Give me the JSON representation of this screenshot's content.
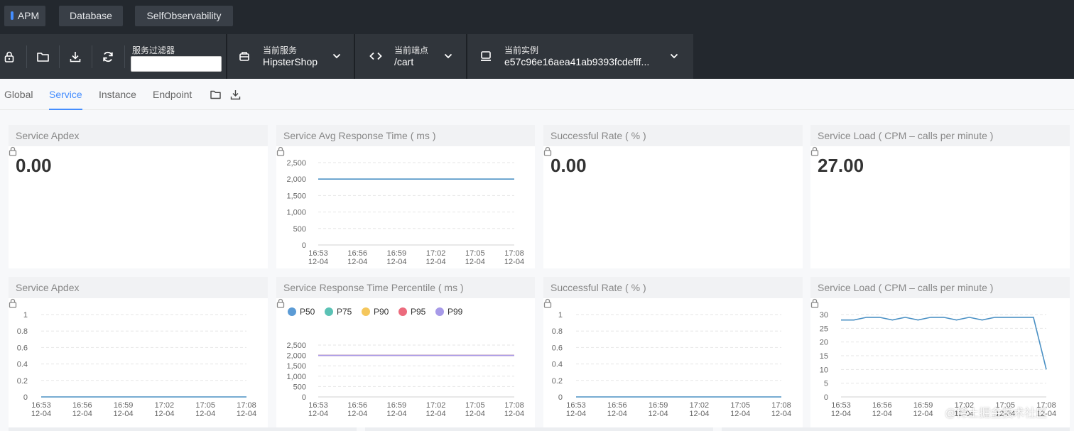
{
  "nav": {
    "tabs": [
      {
        "label": "APM",
        "active": true
      },
      {
        "label": "Database",
        "active": false
      },
      {
        "label": "SelfObservability",
        "active": false
      }
    ]
  },
  "toolbar": {
    "icons": [
      "lock-icon",
      "folder-icon",
      "download-icon",
      "refresh-icon"
    ],
    "filter": {
      "label": "服务过滤器",
      "value": ""
    },
    "service": {
      "label": "当前服务",
      "value": "HipsterShop"
    },
    "endpoint": {
      "label": "当前端点",
      "value": "/cart"
    },
    "instance": {
      "label": "当前实例",
      "value": "e57c96e16aea41ab9393fcdefff..."
    }
  },
  "tabs": [
    {
      "label": "Global",
      "active": false
    },
    {
      "label": "Service",
      "active": true
    },
    {
      "label": "Instance",
      "active": false
    },
    {
      "label": "Endpoint",
      "active": false
    }
  ],
  "panels": {
    "apdex": {
      "title": "Service Apdex",
      "value": "0.00"
    },
    "avg_resp": {
      "title": "Service Avg Response Time ( ms )"
    },
    "success_rate": {
      "title": "Successful Rate ( % )",
      "value": "0.00"
    },
    "load": {
      "title": "Service Load ( CPM – calls per minute )",
      "value": "27.00"
    },
    "apdex_chart": {
      "title": "Service Apdex"
    },
    "percentile": {
      "title": "Service Response Time Percentile ( ms )"
    },
    "success_chart": {
      "title": "Successful Rate ( % )"
    },
    "load_chart": {
      "title": "Service Load ( CPM – calls per minute )"
    }
  },
  "watermark": "@稀土掘金技术社区",
  "colors": {
    "accent": "#448dfe",
    "series_p50": "#5b9bd5",
    "series_p75": "#5bc2b5",
    "series_p90": "#f5c75c",
    "series_p95": "#ec6b7d",
    "series_p99": "#a79ae8"
  },
  "chart_data": [
    {
      "id": "avg_resp",
      "type": "line",
      "x_ticks": [
        [
          "16:53",
          "12-04"
        ],
        [
          "16:56",
          "12-04"
        ],
        [
          "16:59",
          "12-04"
        ],
        [
          "17:02",
          "12-04"
        ],
        [
          "17:05",
          "12-04"
        ],
        [
          "17:08",
          "12-04"
        ]
      ],
      "y_ticks": [
        "2,500",
        "2,000",
        "1,500",
        "1,000",
        "500",
        "0"
      ],
      "ylim": [
        0,
        2500
      ],
      "grid": true,
      "series": [
        {
          "values": [
            2000,
            2000,
            2000,
            2000,
            2000,
            2000,
            2000,
            2000,
            2000,
            2000,
            2000,
            2000,
            2000,
            2000,
            2000,
            2000
          ],
          "color": "#4a90c4"
        }
      ]
    },
    {
      "id": "apdex_chart",
      "type": "line",
      "x_ticks": [
        [
          "16:53",
          "12-04"
        ],
        [
          "16:56",
          "12-04"
        ],
        [
          "16:59",
          "12-04"
        ],
        [
          "17:02",
          "12-04"
        ],
        [
          "17:05",
          "12-04"
        ],
        [
          "17:08",
          "12-04"
        ]
      ],
      "y_ticks": [
        "1",
        "0.8",
        "0.6",
        "0.4",
        "0.2",
        "0"
      ],
      "ylim": [
        0,
        1
      ],
      "grid": true,
      "series": [
        {
          "values": [
            0,
            0,
            0,
            0,
            0,
            0,
            0,
            0,
            0,
            0,
            0,
            0,
            0,
            0,
            0,
            0
          ],
          "color": "#4a90c4"
        }
      ]
    },
    {
      "id": "percentile",
      "type": "line",
      "x_ticks": [
        [
          "16:53",
          "12-04"
        ],
        [
          "16:56",
          "12-04"
        ],
        [
          "16:59",
          "12-04"
        ],
        [
          "17:02",
          "12-04"
        ],
        [
          "17:05",
          "12-04"
        ],
        [
          "17:08",
          "12-04"
        ]
      ],
      "y_ticks": [
        "2,500",
        "2,000",
        "1,500",
        "1,000",
        "500",
        "0"
      ],
      "ylim": [
        0,
        2500
      ],
      "grid": true,
      "legend": "top-left",
      "series": [
        {
          "name": "P50",
          "values": [
            2000,
            2000,
            2000,
            2000,
            2000,
            2000,
            2000,
            2000,
            2000,
            2000,
            2000,
            2000,
            2000,
            2000,
            2000,
            2000
          ],
          "color": "#5b9bd5"
        },
        {
          "name": "P75",
          "values": [
            2000,
            2000,
            2000,
            2000,
            2000,
            2000,
            2000,
            2000,
            2000,
            2000,
            2000,
            2000,
            2000,
            2000,
            2000,
            2000
          ],
          "color": "#5bc2b5"
        },
        {
          "name": "P90",
          "values": [
            2000,
            2000,
            2000,
            2000,
            2000,
            2000,
            2000,
            2000,
            2000,
            2000,
            2000,
            2000,
            2000,
            2000,
            2000,
            2000
          ],
          "color": "#f5c75c"
        },
        {
          "name": "P95",
          "values": [
            2000,
            2000,
            2000,
            2000,
            2000,
            2000,
            2000,
            2000,
            2000,
            2000,
            2000,
            2000,
            2000,
            2000,
            2000,
            2000
          ],
          "color": "#ec6b7d"
        },
        {
          "name": "P99",
          "values": [
            2000,
            2000,
            2000,
            2000,
            2000,
            2000,
            2000,
            2000,
            2000,
            2000,
            2000,
            2000,
            2000,
            2000,
            2000,
            2000
          ],
          "color": "#a79ae8"
        }
      ]
    },
    {
      "id": "success_chart",
      "type": "line",
      "x_ticks": [
        [
          "16:53",
          "12-04"
        ],
        [
          "16:56",
          "12-04"
        ],
        [
          "16:59",
          "12-04"
        ],
        [
          "17:02",
          "12-04"
        ],
        [
          "17:05",
          "12-04"
        ],
        [
          "17:08",
          "12-04"
        ]
      ],
      "y_ticks": [
        "1",
        "0.8",
        "0.6",
        "0.4",
        "0.2",
        "0"
      ],
      "ylim": [
        0,
        1
      ],
      "grid": true,
      "series": [
        {
          "values": [
            0,
            0,
            0,
            0,
            0,
            0,
            0,
            0,
            0,
            0,
            0,
            0,
            0,
            0,
            0,
            0
          ],
          "color": "#4a90c4"
        }
      ]
    },
    {
      "id": "load_chart",
      "type": "line",
      "x_ticks": [
        [
          "16:53",
          "12-04"
        ],
        [
          "16:56",
          "12-04"
        ],
        [
          "16:59",
          "12-04"
        ],
        [
          "17:02",
          "12-04"
        ],
        [
          "17:05",
          "12-04"
        ],
        [
          "17:08",
          "12-04"
        ]
      ],
      "y_ticks": [
        "30",
        "25",
        "20",
        "15",
        "10",
        "5",
        "0"
      ],
      "ylim": [
        0,
        30
      ],
      "grid": true,
      "series": [
        {
          "values": [
            28,
            28,
            29,
            29,
            28,
            29,
            28,
            29,
            29,
            28,
            29,
            28,
            29,
            29,
            29,
            29,
            10
          ],
          "color": "#4a90c4"
        }
      ]
    }
  ]
}
